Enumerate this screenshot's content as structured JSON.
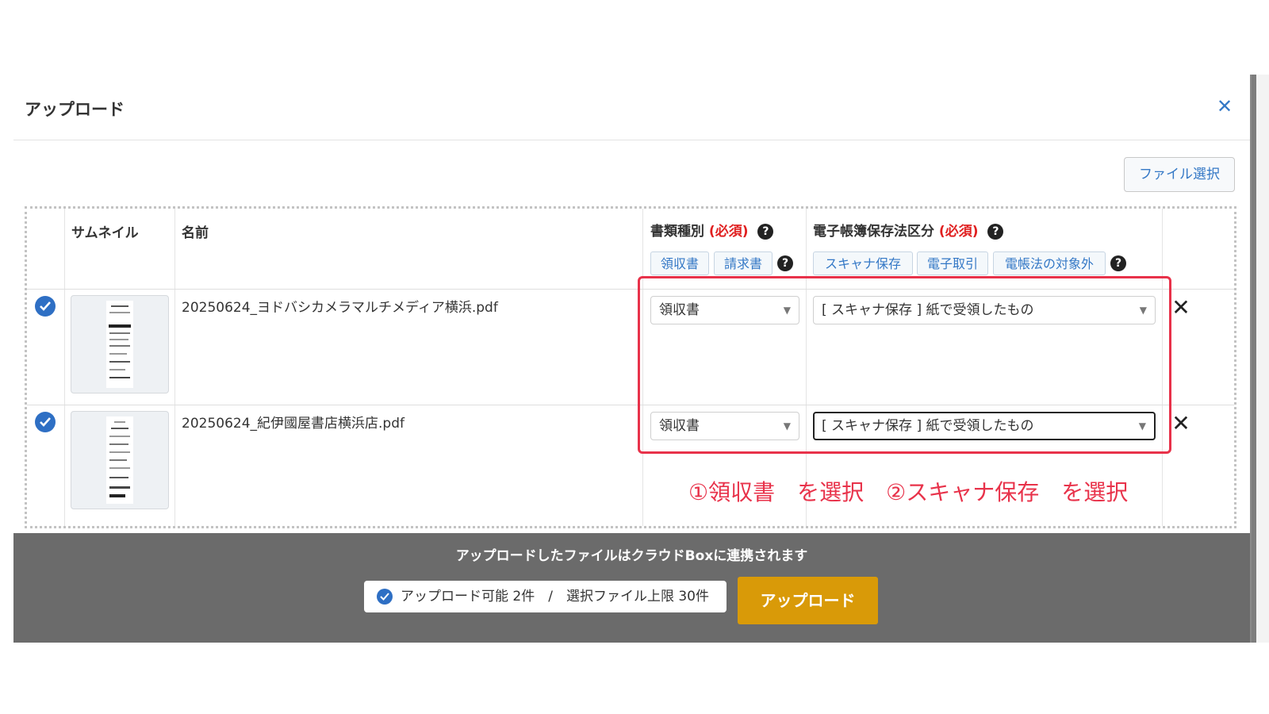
{
  "modal": {
    "title": "アップロード",
    "file_select_label": "ファイル選択"
  },
  "table": {
    "headers": {
      "thumbnail": "サムネイル",
      "name": "名前",
      "doc_type": "書類種別",
      "doc_type_required": "(必須)",
      "storage": "電子帳簿保存法区分",
      "storage_required": "(必須)"
    },
    "doc_type_quick": [
      "領収書",
      "請求書"
    ],
    "storage_quick": [
      "スキャナ保存",
      "電子取引",
      "電帳法の対象外"
    ],
    "rows": [
      {
        "filename": "20250624_ヨドバシカメラマルチメディア横浜.pdf",
        "doc_type": "領収書",
        "storage": "[ スキャナ保存 ] 紙で受領したもの",
        "checked": true
      },
      {
        "filename": "20250624_紀伊國屋書店横浜店.pdf",
        "doc_type": "領収書",
        "storage": "[ スキャナ保存 ] 紙で受領したもの",
        "checked": true
      }
    ]
  },
  "annotation": "①領収書　を選択　②スキャナ保存　を選択",
  "footer": {
    "message": "アップロードしたファイルはクラウドBoxに連携されます",
    "status": "アップロード可能 2件　/　選択ファイル上限 30件",
    "upload_label": "アップロード"
  },
  "colors": {
    "accent": "#3478c6",
    "required": "#e02020",
    "annotation": "#e8324a",
    "upload_button": "#d99a08",
    "footer_bg": "#6b6b6b"
  }
}
